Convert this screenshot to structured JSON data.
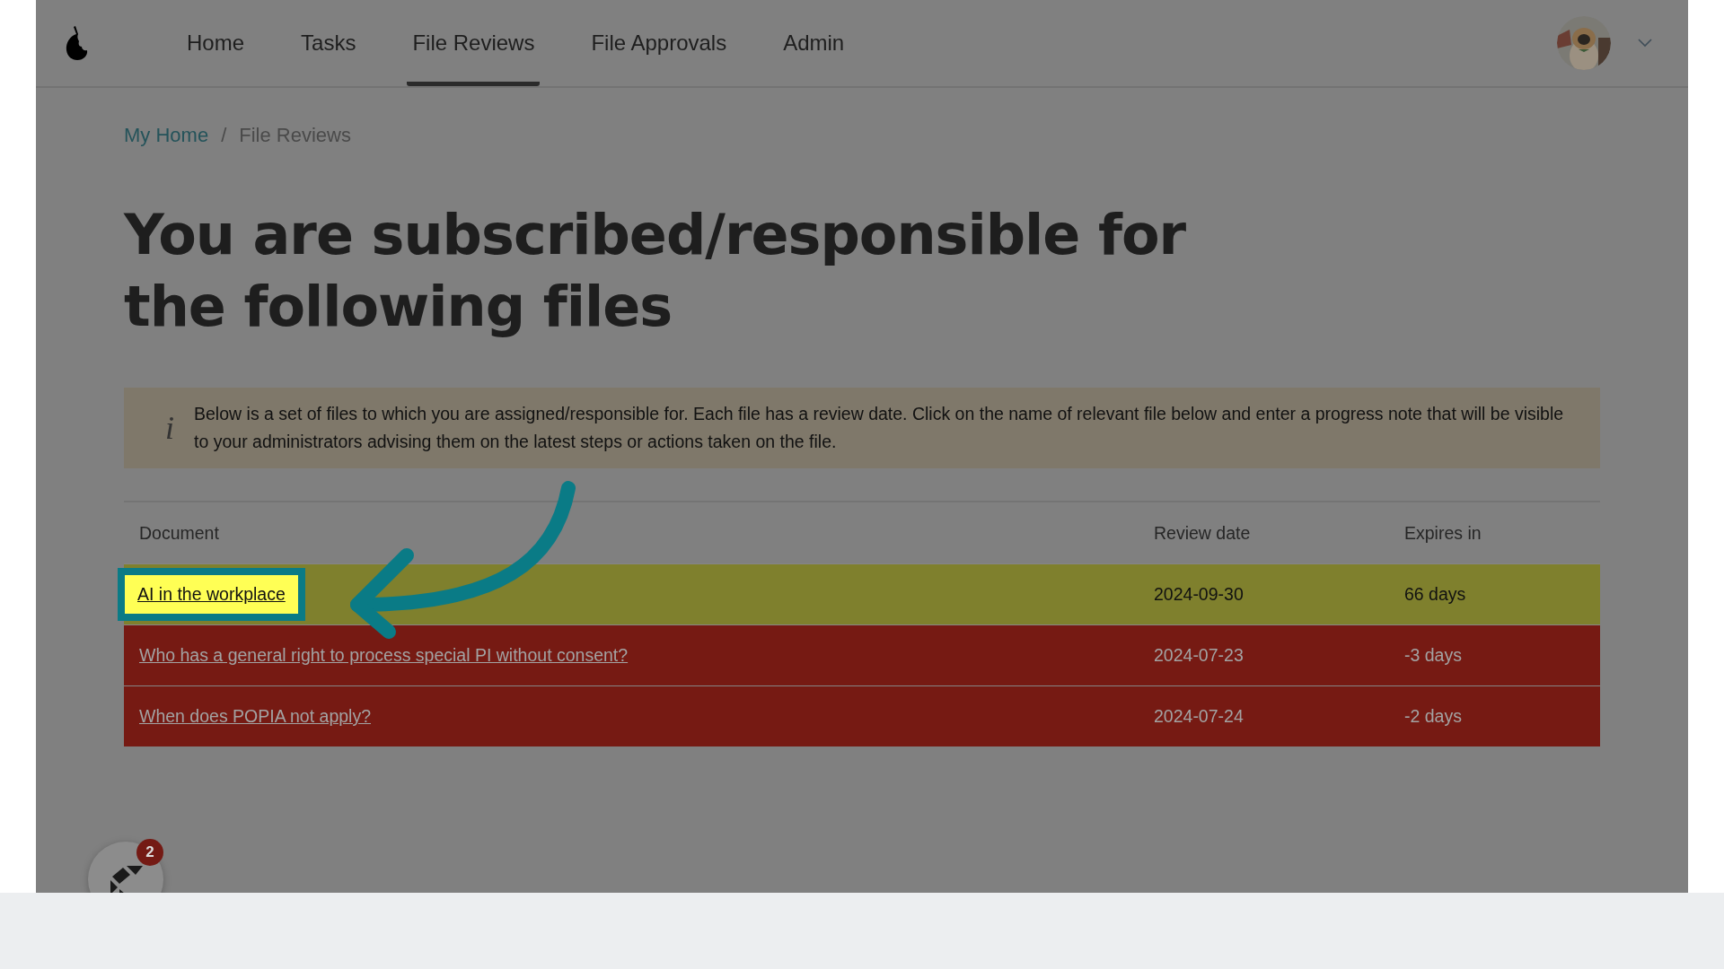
{
  "nav": {
    "items": [
      {
        "label": "Home",
        "selected": false
      },
      {
        "label": "Tasks",
        "selected": false
      },
      {
        "label": "File Reviews",
        "selected": true
      },
      {
        "label": "File Approvals",
        "selected": false
      },
      {
        "label": "Admin",
        "selected": false
      }
    ]
  },
  "breadcrumb": {
    "link": "My Home",
    "separator": "/",
    "current": "File Reviews"
  },
  "heading": "You are subscribed/responsible for the following files",
  "info": {
    "icon": "i",
    "text": "Below is a set of files to which you are assigned/responsible for. Each file has a review date. Click on the name of relevant file below and enter a progress note that will be visible to your administrators advising them on the latest steps or actions taken on the file."
  },
  "table": {
    "columns": [
      "Document",
      "Review date",
      "Expires in"
    ],
    "rows": [
      {
        "document": "AI in the workplace",
        "review_date": "2024-09-30",
        "expires_in": "66 days",
        "color": "#7f802d",
        "highlighted": true
      },
      {
        "document": "Who has a general right to process special PI without consent?",
        "review_date": "2024-07-23",
        "expires_in": "-3 days",
        "color": "#761a13",
        "highlighted": false
      },
      {
        "document": "When does POPIA not apply?",
        "review_date": "2024-07-24",
        "expires_in": "-2 days",
        "color": "#761a13",
        "highlighted": false
      }
    ]
  },
  "chat": {
    "badge": "2"
  }
}
